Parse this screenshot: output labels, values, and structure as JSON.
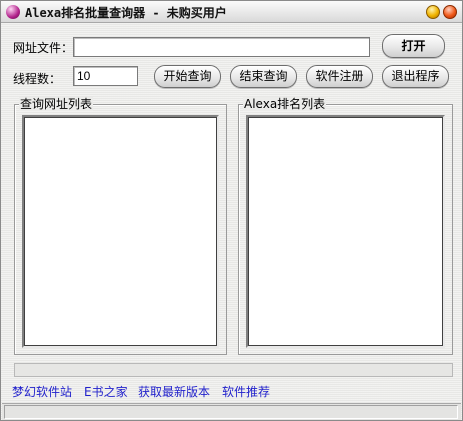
{
  "window": {
    "title": "Alexa排名批量查询器 - 未购买用户"
  },
  "form": {
    "url_file_label": "网址文件：",
    "url_file_value": "",
    "open_button": "打开",
    "thread_label": "线程数：",
    "thread_value": "10",
    "start_button": "开始查询",
    "stop_button": "结束查询",
    "register_button": "软件注册",
    "exit_button": "退出程序"
  },
  "lists": {
    "url_list_title": "查询网址列表",
    "rank_list_title": "Alexa排名列表"
  },
  "progress": {
    "value": 0
  },
  "links": [
    "梦幻软件站",
    "E书之家",
    "获取最新版本",
    "软件推荐"
  ],
  "status": {
    "text": ""
  },
  "colors": {
    "link": "#2222cc",
    "close_button": "#f05a1a",
    "minimize_button": "#f0b400"
  }
}
